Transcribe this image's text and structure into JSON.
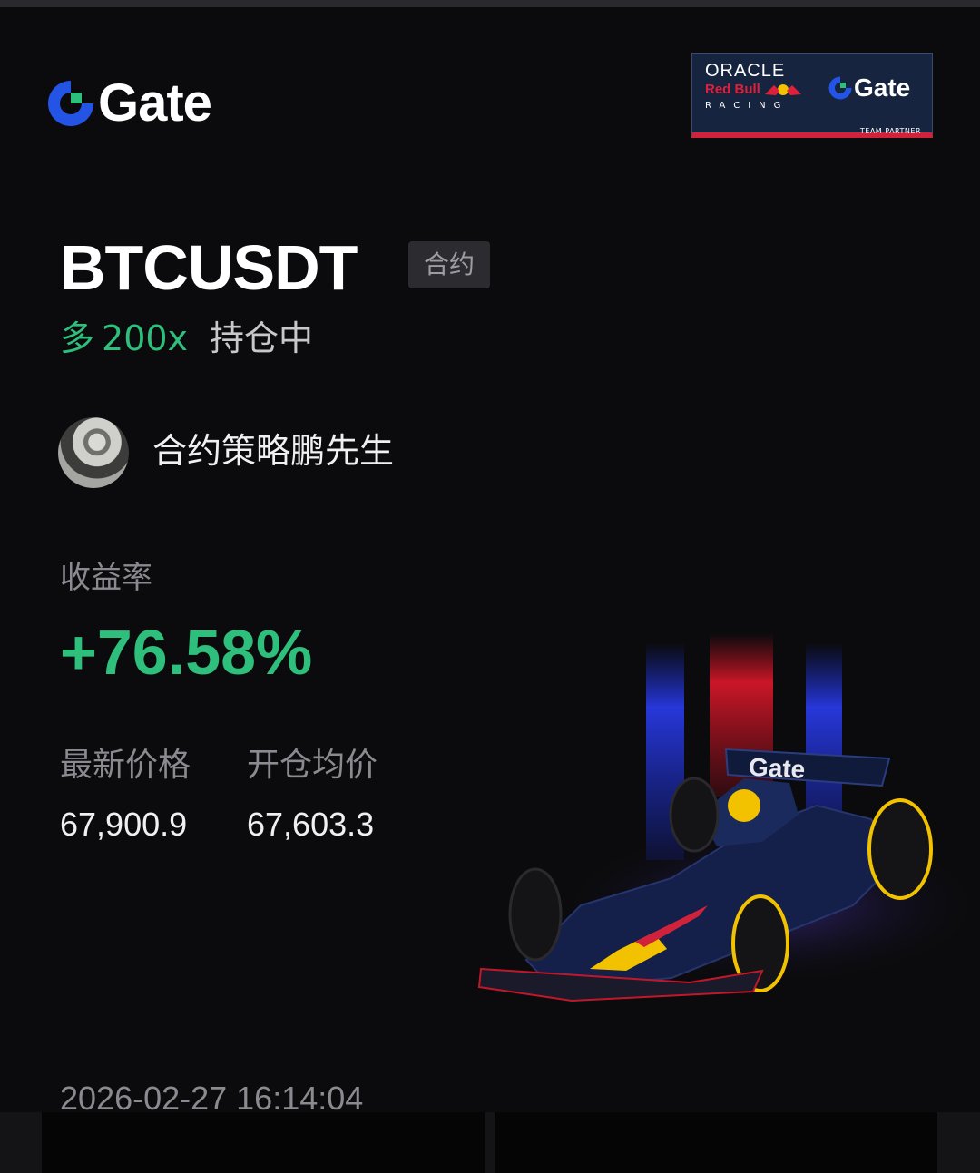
{
  "brand": {
    "name": "Gate",
    "accent": "#2354e6"
  },
  "partner_badge": {
    "line1": "ORACLE",
    "line2": "Red Bull",
    "line3": "RACING",
    "gate": "Gate",
    "footer": "TEAM PARTNER"
  },
  "position": {
    "symbol": "BTCUSDT",
    "tag": "合约",
    "side": "多",
    "leverage": "200x",
    "status": "持仓中",
    "side_color": "#2fbf7c"
  },
  "author": {
    "name": "合约策略鹏先生"
  },
  "profit": {
    "label": "收益率",
    "value": "+76.58%"
  },
  "prices": {
    "latest_label": "最新价格",
    "latest_value": "67,900.9",
    "entry_label": "开仓均价",
    "entry_value": "67,603.3"
  },
  "timestamp": "2026-02-27 16:14:04",
  "car_livery": "Gate"
}
